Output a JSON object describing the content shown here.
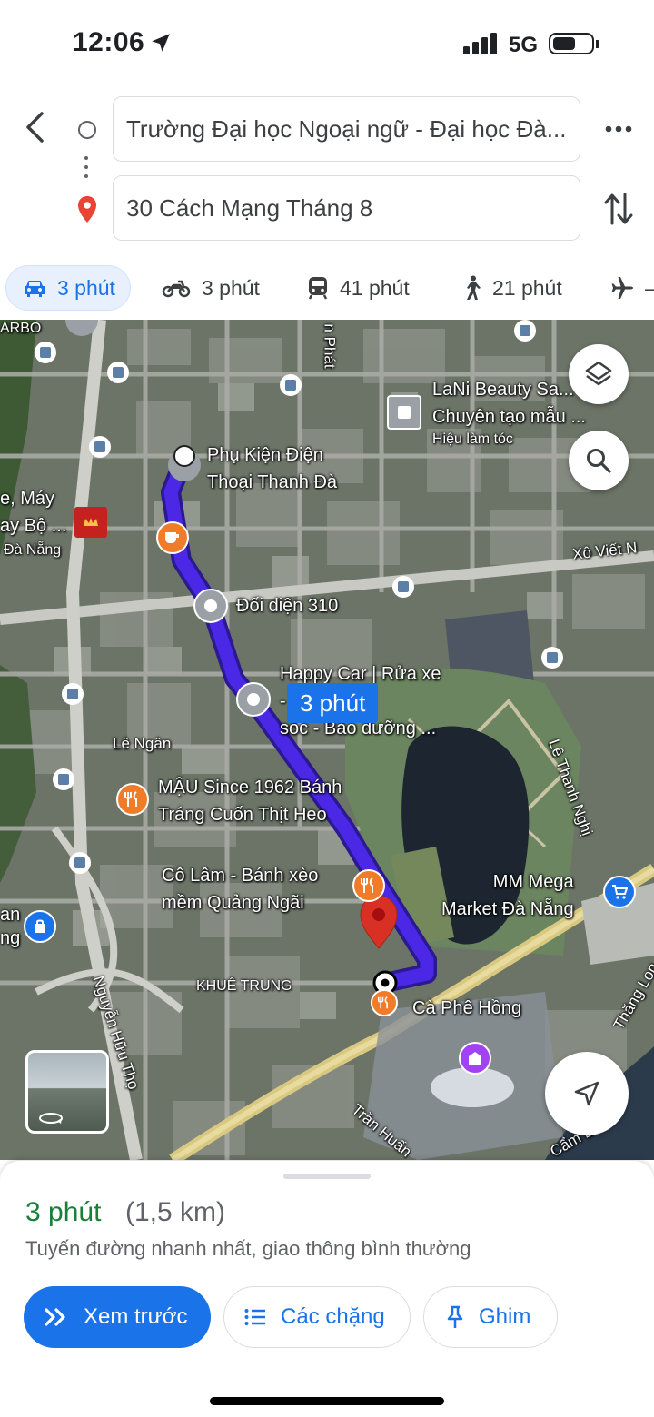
{
  "status_bar": {
    "time": "12:06",
    "network": "5G"
  },
  "route": {
    "origin": "Trường Đại học Ngoại ngữ - Đại học Đà...",
    "destination": "30 Cách Mạng Tháng 8"
  },
  "modes": [
    {
      "icon": "car-icon",
      "label": "3 phút"
    },
    {
      "icon": "motorbike-icon",
      "label": "3 phút"
    },
    {
      "icon": "transit-icon",
      "label": "41 phút"
    },
    {
      "icon": "walk-icon",
      "label": "21 phút"
    },
    {
      "icon": "flight-icon",
      "label": "–"
    }
  ],
  "map": {
    "route_badge": "3 phút",
    "labels": {
      "phu_kien": "Phụ Kiện Điện\nThoại Thanh Đà",
      "doi_dien": "Đối diện 310",
      "happy_car": "Happy Car | Rửa xe\n- Chăm\nsóc - Bảo dưỡng ...",
      "lani": "LaNi Beauty Sa...\nChuyên tạo mẫu ...",
      "lani_sub": "Hiệu làm tóc",
      "mau": "MẬU Since 1962 Bánh\nTráng Cuốn Thịt Heo",
      "co_lam": "Cô Lâm - Bánh xèo\nmềm Quảng Ngãi",
      "mm_mega": "MM Mega\nMarket Đà Nẵng",
      "ca_phe": "Cà Phê Hồng",
      "khue_trung": "KHUÊ TRUNG",
      "le_ngan": "Lê Ngân",
      "xo_viet": "Xô Viết N",
      "le_thanh_nghi": "Lê Thanh Nghị",
      "nguyen_huu_tho": "Nguyễn Hữu Thọ",
      "tran_huan": "Trần Huấn",
      "thang_long": "Thăng Lon",
      "cam_le": "Cẩm L",
      "phat": "n Phát",
      "may": "e, Máy\nay Bộ ...",
      "da_nang": "Đà Nẵng",
      "an": "an\nng",
      "arbo": "ARBO"
    }
  },
  "sheet": {
    "eta": "3 phút",
    "distance": "(1,5 km)",
    "description": "Tuyến đường nhanh nhất, giao thông bình thường",
    "buttons": {
      "preview": "Xem trước",
      "steps": "Các chặng",
      "pin": "Ghim"
    }
  },
  "colors": {
    "accent": "#1a73e8",
    "route": "#4a28e6",
    "eta_green": "#188038"
  }
}
